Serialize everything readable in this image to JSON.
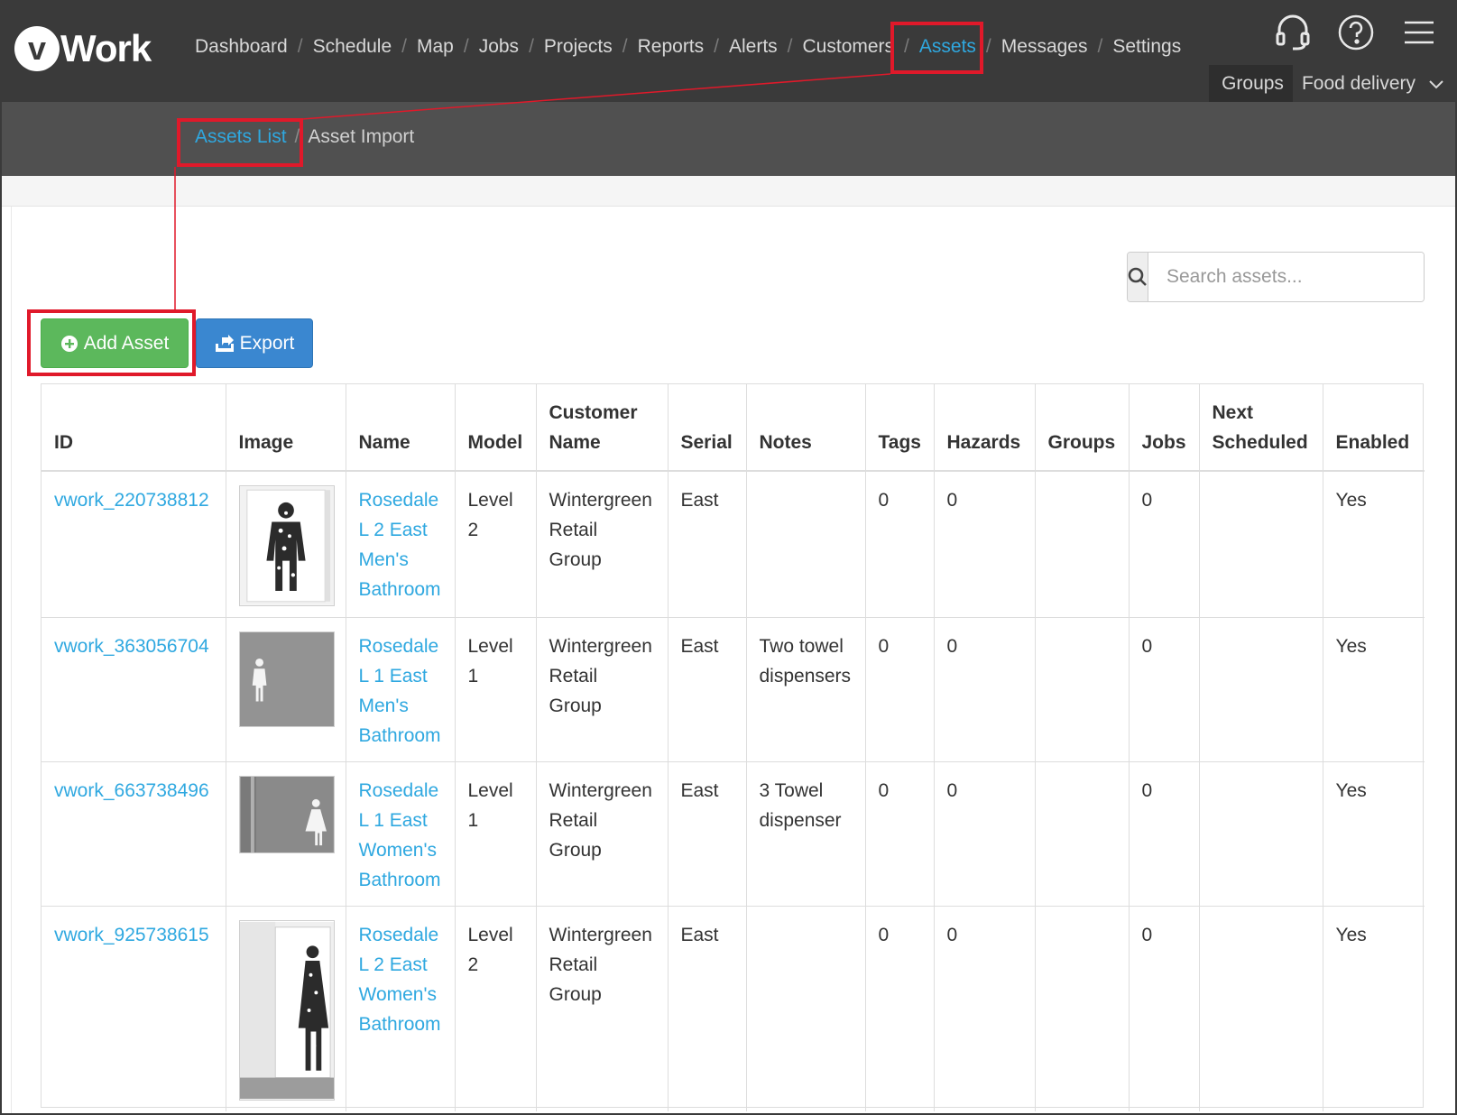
{
  "header": {
    "logo_mark": "v",
    "logo_text": "Work",
    "nav": [
      {
        "label": "Dashboard"
      },
      {
        "label": "Schedule"
      },
      {
        "label": "Map"
      },
      {
        "label": "Jobs"
      },
      {
        "label": "Projects"
      },
      {
        "label": "Reports"
      },
      {
        "label": "Alerts"
      },
      {
        "label": "Customers"
      },
      {
        "label": "Assets",
        "active": true
      },
      {
        "label": "Messages"
      },
      {
        "label": "Settings"
      }
    ],
    "icons": [
      "headset-icon",
      "help-icon",
      "hamburger-menu-icon"
    ],
    "groups_label": "Groups",
    "groups_value": "Food delivery"
  },
  "subnav": {
    "items": [
      {
        "label": "Assets List",
        "active": true
      },
      {
        "label": "Asset Import"
      }
    ]
  },
  "toolbar": {
    "add_label": "Add Asset",
    "export_label": "Export",
    "search_placeholder": "Search assets..."
  },
  "table": {
    "columns": [
      "ID",
      "Image",
      "Name",
      "Model",
      "Customer Name",
      "Serial",
      "Notes",
      "Tags",
      "Hazards",
      "Groups",
      "Jobs",
      "Next Scheduled",
      "Enabled"
    ],
    "rows": [
      {
        "id": "vwork_220738812",
        "image": "mens-bathroom-door-photo",
        "name": "Rosedale L 2 East Men's Bathroom",
        "model": "Level 2",
        "customer": "Wintergreen Retail Group",
        "serial": "East",
        "notes": "",
        "tags": "0",
        "hazards": "0",
        "groups": "",
        "jobs": "0",
        "next": "",
        "enabled": "Yes"
      },
      {
        "id": "vwork_363056704",
        "image": "mens-sign-wall-photo",
        "name": "Rosedale L 1 East Men's Bathroom",
        "model": "Level 1",
        "customer": "Wintergreen Retail Group",
        "serial": "East",
        "notes": "Two towel dispensers",
        "tags": "0",
        "hazards": "0",
        "groups": "",
        "jobs": "0",
        "next": "",
        "enabled": "Yes"
      },
      {
        "id": "vwork_663738496",
        "image": "womens-sign-wall-photo",
        "name": "Rosedale L 1 East Women's Bathroom",
        "model": "Level 1",
        "customer": "Wintergreen Retail Group",
        "serial": "East",
        "notes": "3 Towel dispenser",
        "tags": "0",
        "hazards": "0",
        "groups": "",
        "jobs": "0",
        "next": "",
        "enabled": "Yes"
      },
      {
        "id": "vwork_925738615",
        "image": "womens-bathroom-door-photo",
        "name": "Rosedale L 2 East Women's Bathroom",
        "model": "Level 2",
        "customer": "Wintergreen Retail Group",
        "serial": "East",
        "notes": "",
        "tags": "0",
        "hazards": "0",
        "groups": "",
        "jobs": "0",
        "next": "",
        "enabled": "Yes"
      }
    ]
  },
  "annotations": {
    "highlight_color": "#e0192a",
    "highlighted": [
      "Assets",
      "Assets List",
      "Add Asset"
    ]
  },
  "colors": {
    "topbar": "#3a3a3a",
    "subbar": "#505050",
    "accent": "#2fa8e0",
    "add_button": "#5cb85c",
    "export_button": "#3a87d0"
  }
}
